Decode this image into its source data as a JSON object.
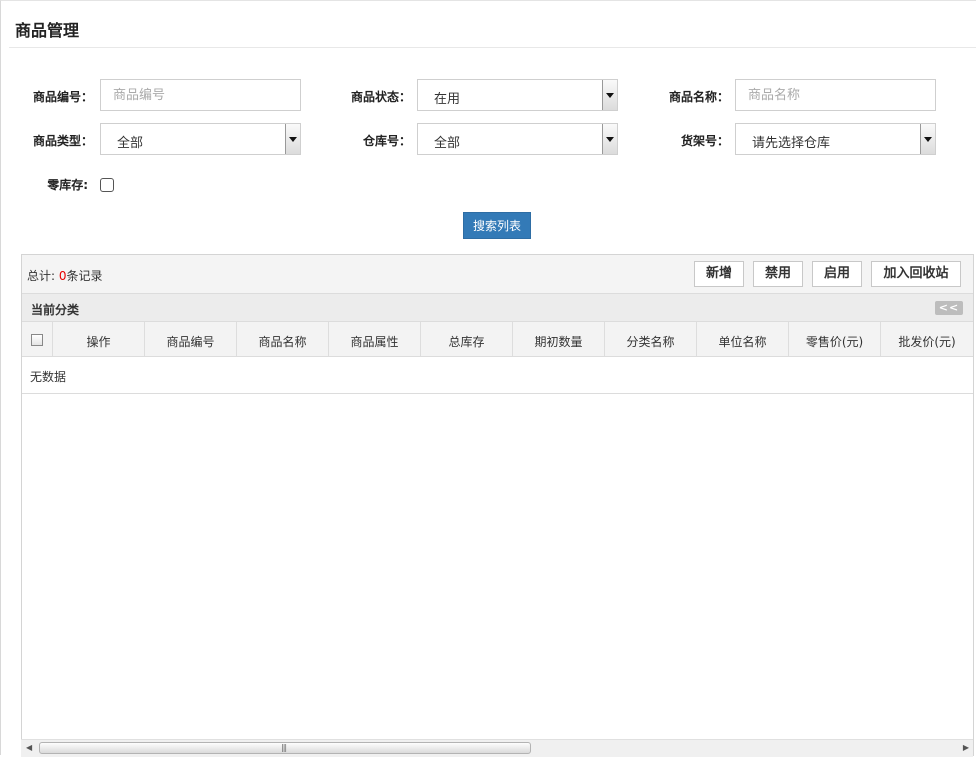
{
  "page": {
    "title": "商品管理"
  },
  "filters": {
    "code": {
      "label": "商品编号：",
      "placeholder": "商品编号"
    },
    "status": {
      "label": "商品状态：",
      "value": "在用"
    },
    "name": {
      "label": "商品名称：",
      "placeholder": "商品名称"
    },
    "type": {
      "label": "商品类型：",
      "value": "全部"
    },
    "warehouse": {
      "label": "仓库号：",
      "value": "全部"
    },
    "shelf": {
      "label": "货架号：",
      "value": "请先选择仓库"
    },
    "zero_stock": {
      "label": "零库存:"
    },
    "search_label": "搜索列表"
  },
  "grid": {
    "total_prefix": "总计: ",
    "total_count": "0",
    "total_suffix": "条记录",
    "buttons": {
      "add": "新增",
      "disable": "禁用",
      "enable": "启用",
      "recycle": "加入回收站"
    },
    "category_title": "当前分类",
    "collapse_label": "<<",
    "columns": [
      "操作",
      "商品编号",
      "商品名称",
      "商品属性",
      "总库存",
      "期初数量",
      "分类名称",
      "单位名称",
      "零售价(元)",
      "批发价(元)"
    ],
    "empty_text": "无数据"
  },
  "colors": {
    "primary": "#337ab7",
    "count": "#e60000"
  }
}
